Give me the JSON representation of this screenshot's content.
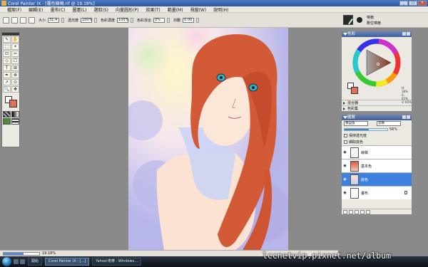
{
  "window": {
    "title": "Corel Painter IX - [覆色線稿.rif @ 19.18%]",
    "controls": [
      "_",
      "□",
      "×"
    ]
  },
  "menu": [
    "檔案(F)",
    "編輯(E)",
    "畫布(C)",
    "圖層(L)",
    "選取(S)",
    "向量圖形(P)",
    "效果(T)",
    "範畫(M)",
    "視窗(W)",
    "說明(H)"
  ],
  "property_bar": {
    "size_label": "大小",
    "size_value": "31.4",
    "opacity_label": "透光度",
    "opacity_value": "100%",
    "resat_label": "色彩濃度",
    "resat_value": "100%",
    "bleed_label": "色彩混合",
    "bleed_value": "0%",
    "jitter_label": "抖動",
    "jitter_value": "0.00"
  },
  "brush_selector": {
    "category": "噴槍",
    "variant": "數位噴槍"
  },
  "toolbox": {
    "tools": [
      "✎",
      "✋",
      "⬚",
      "⌖",
      "⊡",
      "✂",
      "◇",
      "☐",
      "T",
      "⊞",
      "✒",
      "⊗",
      "↗",
      "⊙",
      "🔍",
      "✥"
    ]
  },
  "color_panel": {
    "title": "色彩",
    "hsv_values": [
      "H: 18%",
      "S: 62%",
      "V: 85%"
    ],
    "mixer_label": "混合器",
    "sets_label": "色彩集"
  },
  "layer_panel": {
    "title": "圖層",
    "composite_method": "預設值",
    "composite_depth": "忽略",
    "opacity": "56%",
    "opacity_fraction": 0.56,
    "preserve_transparency_label": "保持透光度",
    "pick_up_color_label": "擷取底色",
    "layers": [
      {
        "name": "線稿",
        "thumb": "lines",
        "selected": false
      },
      {
        "name": "基本色",
        "thumb": "base",
        "selected": false
      },
      {
        "name": "底色",
        "thumb": "bgl",
        "selected": true
      },
      {
        "name": "畫布",
        "thumb": "white",
        "selected": false
      }
    ]
  },
  "status_bar": {
    "zoom": "19.18%",
    "progress_fraction": 0.55
  },
  "taskbar": {
    "tasks": [
      "開始",
      "Corel Painter IX - [...]",
      "Yahoo!奇摩 - Windows..."
    ],
    "active_task_index": 1
  },
  "watermark": "lccnetvip.pixnet.net/album",
  "colors": {
    "hair": "#d35a36",
    "eyes": "#2fb4c2",
    "current_color": "#e07058",
    "selection_blue": "#3e82e0"
  }
}
